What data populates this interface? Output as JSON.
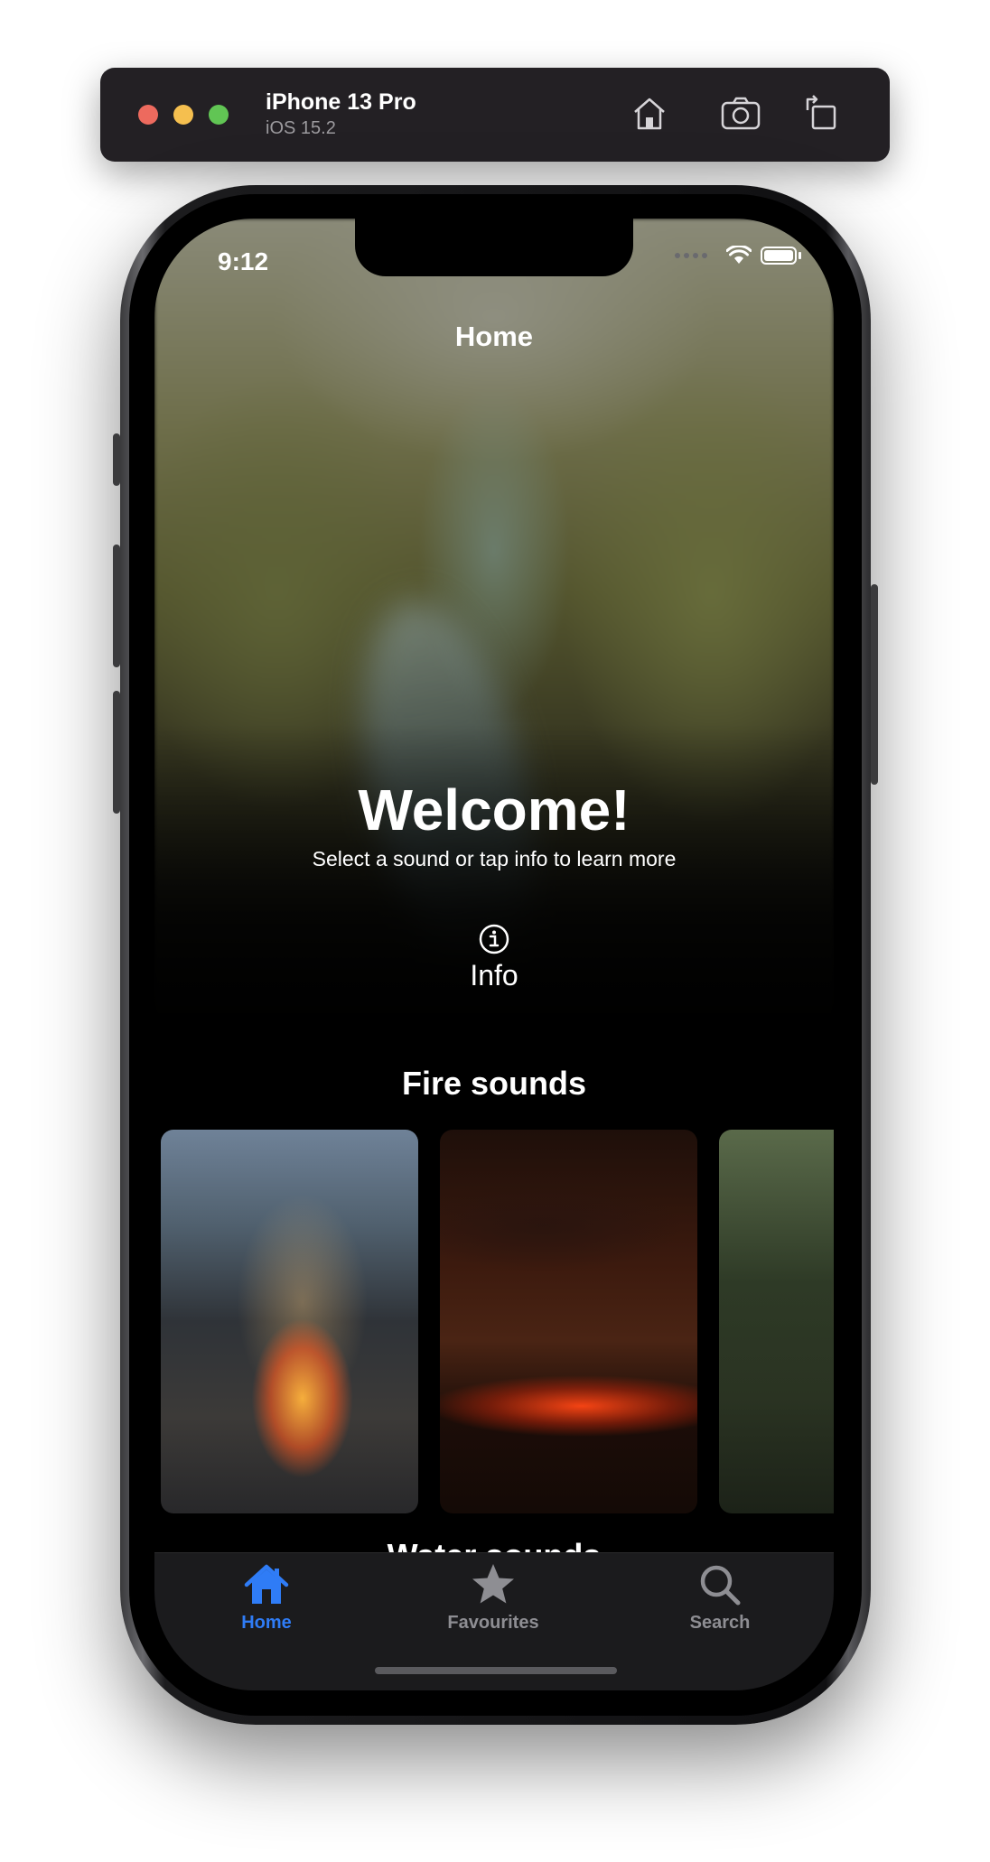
{
  "simulator": {
    "device_name": "iPhone 13 Pro",
    "os_version": "iOS 15.2",
    "buttons": [
      "home-icon",
      "screenshot-icon",
      "rotate-icon"
    ]
  },
  "status_bar": {
    "time": "9:12"
  },
  "nav": {
    "title": "Home"
  },
  "hero": {
    "heading": "Welcome!",
    "subtitle": "Select a sound or tap info to learn more",
    "info_label": "Info"
  },
  "sections": [
    {
      "title": "Fire sounds",
      "cards": [
        {
          "image": "campfire"
        },
        {
          "image": "lava"
        },
        {
          "image": "sparkler"
        }
      ]
    },
    {
      "title": "Water sounds"
    }
  ],
  "tabbar": {
    "items": [
      {
        "label": "Home",
        "icon": "house-icon",
        "selected": true
      },
      {
        "label": "Favourites",
        "icon": "star-icon",
        "selected": false
      },
      {
        "label": "Search",
        "icon": "magnifier-icon",
        "selected": false
      }
    ]
  },
  "colors": {
    "accent": "#2f7cf6",
    "tab_inactive": "#8e8e93",
    "tabbar_bg": "#1b1b1d",
    "toolbar_bg": "#232024"
  }
}
